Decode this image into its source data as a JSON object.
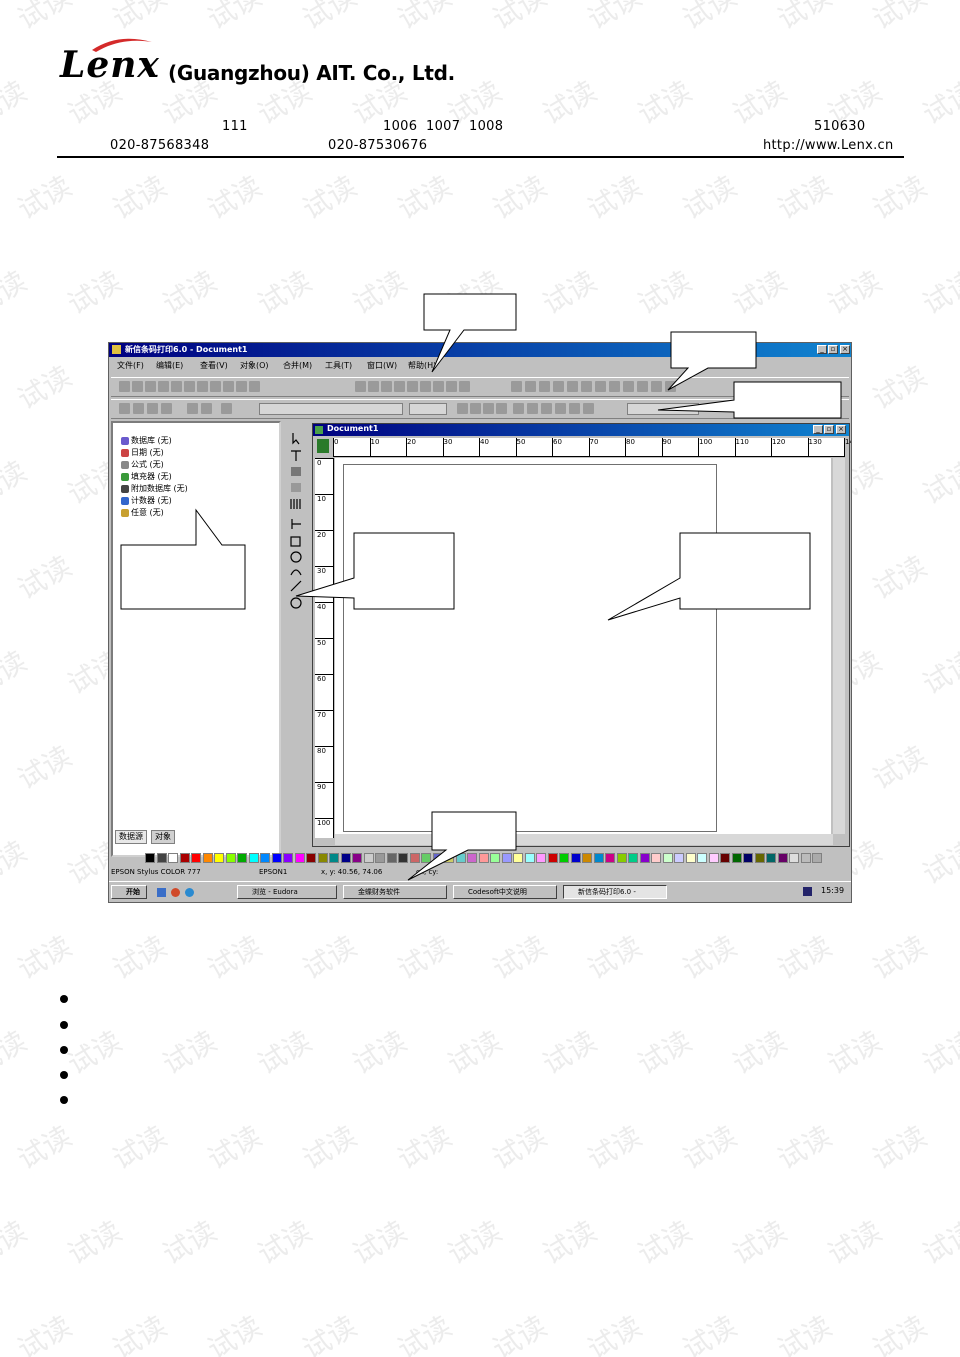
{
  "header": {
    "logo_text": "Lenx",
    "company": "(Guangzhou) AIT. Co., Ltd.",
    "address_num": "111",
    "rooms": [
      "1006",
      "1007",
      "1008"
    ],
    "postcode": "510630",
    "phone1": "020-87568348",
    "phone2": "020-87530676",
    "website": "http://www.Lenx.cn"
  },
  "app": {
    "title": "新信条码打印6.0 - Document1",
    "menus": [
      "文件(F)",
      "编辑(E)",
      "查看(V)",
      "对象(O)",
      "合并(M)",
      "工具(T)",
      "窗口(W)",
      "帮助(H)"
    ],
    "panel_items": [
      "数据库 (无)",
      "日期 (无)",
      "公式 (无)",
      "填充器 (无)",
      "附加数据库 (无)",
      "计数器 (无)",
      "任意 (无)"
    ],
    "panel_tabs": [
      "数据源",
      "对象"
    ],
    "doc_title": "Document1",
    "ruler_h": [
      "0",
      "10",
      "20",
      "30",
      "40",
      "50",
      "60",
      "70",
      "80",
      "90",
      "100",
      "110",
      "120",
      "130",
      "14"
    ],
    "ruler_v": [
      "0",
      "10",
      "20",
      "30",
      "40",
      "50",
      "60",
      "70",
      "80",
      "90",
      "100"
    ],
    "status": {
      "printer": "EPSON Stylus COLOR 777",
      "port": "EPSON1",
      "coords": "x, y: 40.56, 74.06",
      "size": "cx, cy:"
    },
    "taskbar": {
      "start": "开始",
      "tasks": [
        "浏览 - Eudora",
        "金蝶财务软件",
        "Codesoft中文说明",
        "新信条码打印6.0 -"
      ],
      "clock": "15:39"
    }
  },
  "colors": {
    "title_blue": "#000080",
    "window_gray": "#c0c0c0",
    "logo_swoosh": "#d42a2a",
    "watermark": "#ececec"
  },
  "icons": [
    "app-icon",
    "tree-icon",
    "tool-icon",
    "palette-swatch",
    "start-icon"
  ]
}
